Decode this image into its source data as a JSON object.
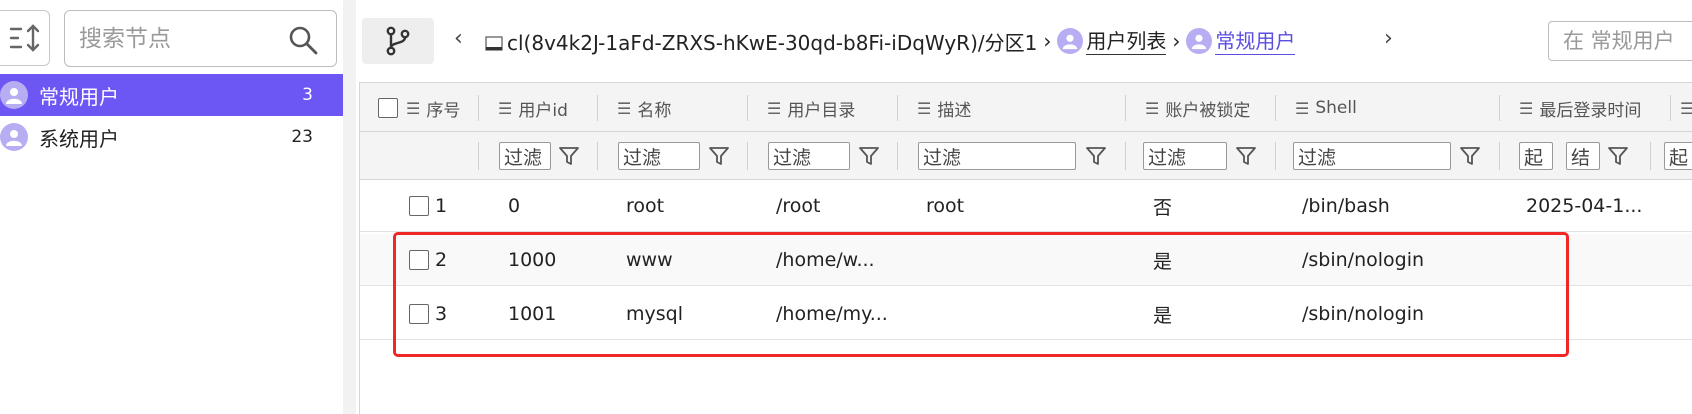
{
  "sidebar": {
    "search_placeholder": "搜索节点",
    "items": [
      {
        "label": "常规用户",
        "count": "3",
        "active": true
      },
      {
        "label": "系统用户",
        "count": "23",
        "active": false
      }
    ]
  },
  "breadcrumb": {
    "path": "cl(8v4k2J-1aFd-ZRXS-hKwE-30qd-b8Fi-iDqWyR)/分区1",
    "sep": "›",
    "items": [
      "用户列表",
      "常规用户"
    ],
    "back": "‹",
    "forward": "›"
  },
  "filter_placeholder": "在 常规用户",
  "table": {
    "columns": [
      "序号",
      "用户id",
      "名称",
      "用户目录",
      "描述",
      "账户被锁定",
      "Shell",
      "最后登录时间"
    ],
    "filter_label": "过滤",
    "date_from": "起",
    "date_to": "结",
    "rows": [
      {
        "idx": "1",
        "uid": "0",
        "name": "root",
        "home": "/root",
        "desc": "root",
        "locked": "否",
        "shell": "/bin/bash",
        "last": "2025-04-1..."
      },
      {
        "idx": "2",
        "uid": "1000",
        "name": "www",
        "home": "/home/w...",
        "desc": "",
        "locked": "是",
        "shell": "/sbin/nologin",
        "last": ""
      },
      {
        "idx": "3",
        "uid": "1001",
        "name": "mysql",
        "home": "/home/my...",
        "desc": "",
        "locked": "是",
        "shell": "/sbin/nologin",
        "last": ""
      }
    ]
  },
  "colors": {
    "accent": "#6c57f5",
    "highlight": "#f02727",
    "avatar": "#b7adf2"
  }
}
